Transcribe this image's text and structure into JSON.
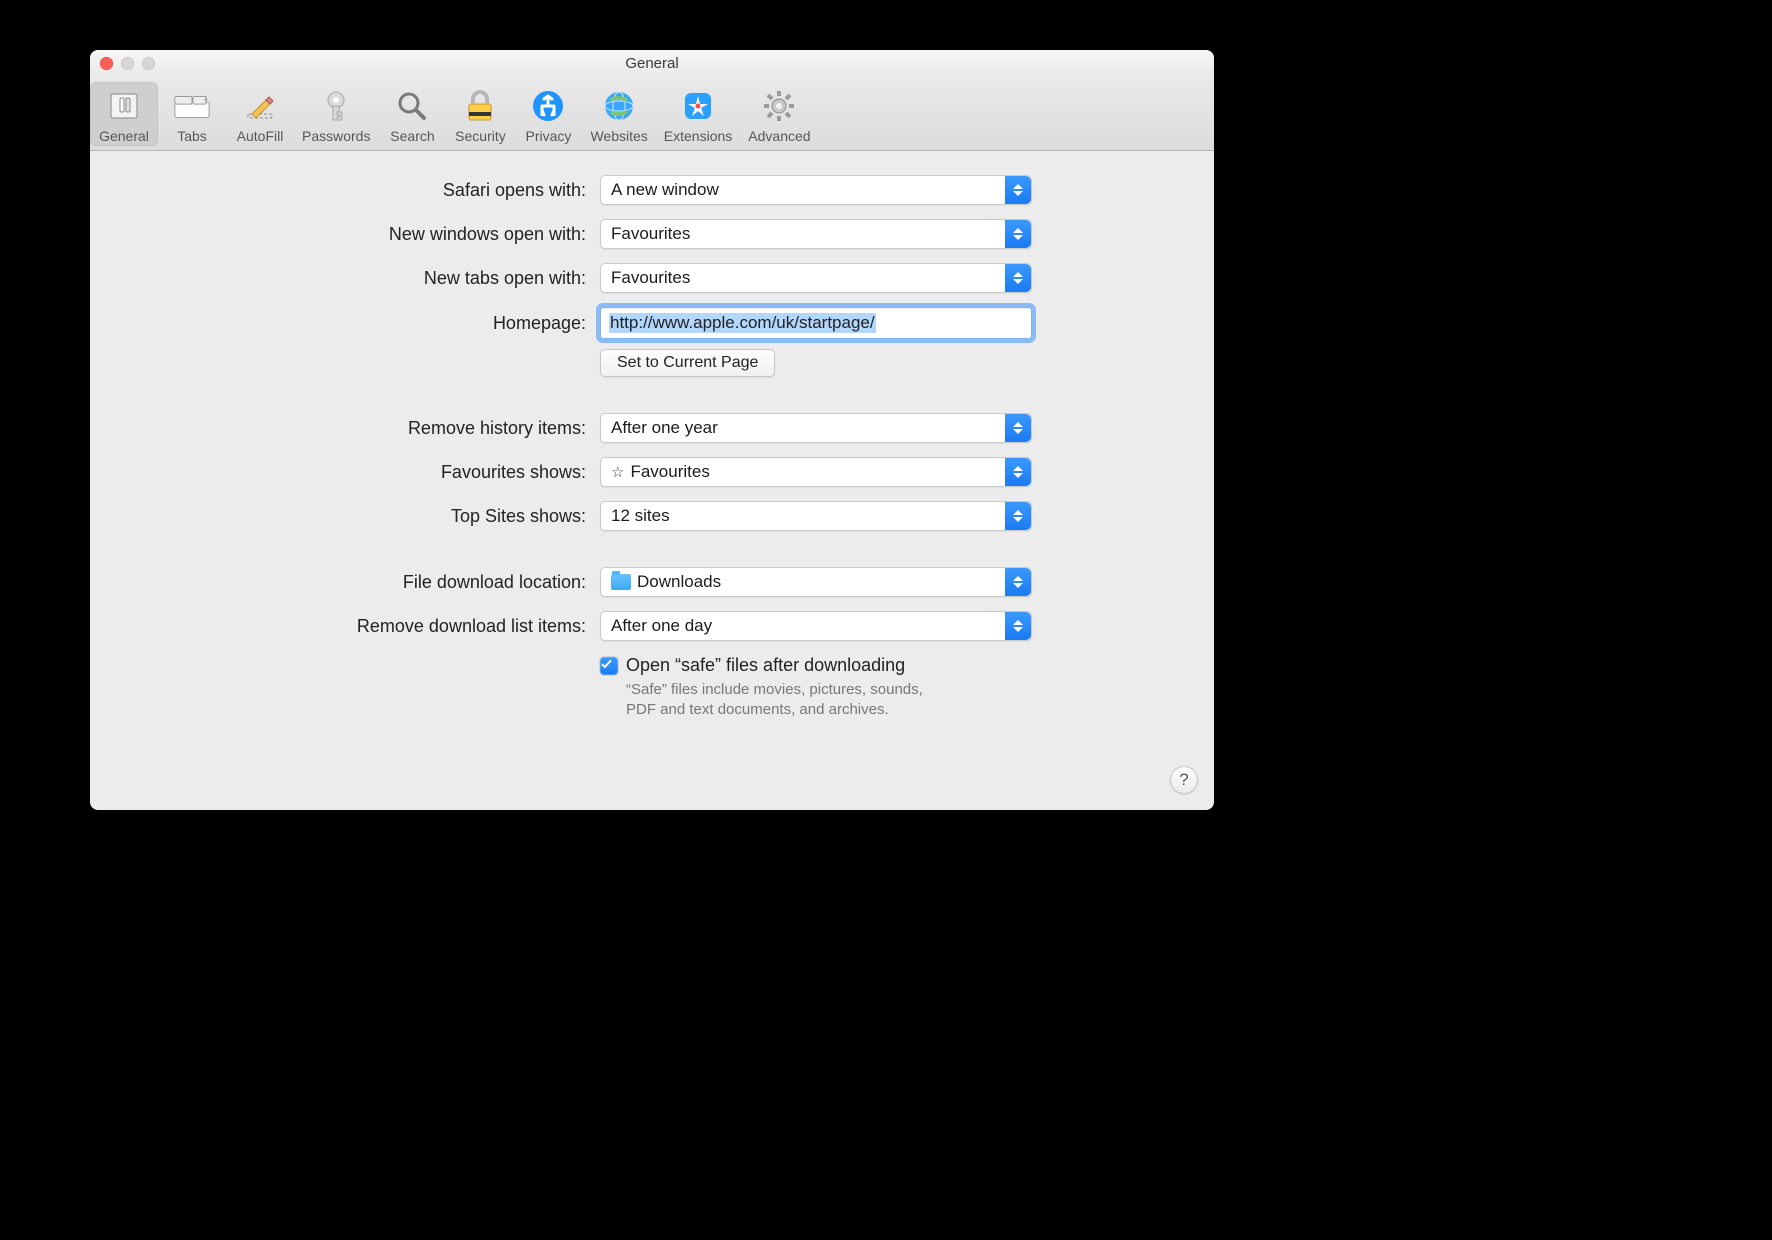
{
  "window": {
    "title": "General"
  },
  "toolbar": {
    "items": [
      {
        "id": "general",
        "label": "General"
      },
      {
        "id": "tabs",
        "label": "Tabs"
      },
      {
        "id": "autofill",
        "label": "AutoFill"
      },
      {
        "id": "passwords",
        "label": "Passwords"
      },
      {
        "id": "search",
        "label": "Search"
      },
      {
        "id": "security",
        "label": "Security"
      },
      {
        "id": "privacy",
        "label": "Privacy"
      },
      {
        "id": "websites",
        "label": "Websites"
      },
      {
        "id": "extensions",
        "label": "Extensions"
      },
      {
        "id": "advanced",
        "label": "Advanced"
      }
    ],
    "selected": "general"
  },
  "form": {
    "safari_opens_with": {
      "label": "Safari opens with:",
      "value": "A new window"
    },
    "new_windows_open_with": {
      "label": "New windows open with:",
      "value": "Favourites"
    },
    "new_tabs_open_with": {
      "label": "New tabs open with:",
      "value": "Favourites"
    },
    "homepage": {
      "label": "Homepage:",
      "value": "http://www.apple.com/uk/startpage/"
    },
    "set_current_page_button": "Set to Current Page",
    "remove_history_items": {
      "label": "Remove history items:",
      "value": "After one year"
    },
    "favourites_shows": {
      "label": "Favourites shows:",
      "value": "Favourites"
    },
    "top_sites_shows": {
      "label": "Top Sites shows:",
      "value": "12 sites"
    },
    "file_download_location": {
      "label": "File download location:",
      "value": "Downloads"
    },
    "remove_download_list": {
      "label": "Remove download list items:",
      "value": "After one day"
    },
    "open_safe_files": {
      "checked": true,
      "label": "Open “safe” files after downloading",
      "description": "“Safe” files include movies, pictures, sounds, PDF and text documents, and archives."
    }
  },
  "help_button": "?"
}
